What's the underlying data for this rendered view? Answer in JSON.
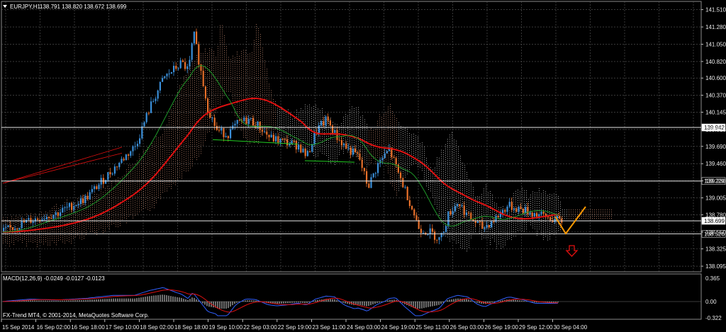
{
  "header": {
    "symbol_label": "EURJPY,H1",
    "ohlc_text": "138.791 138.820 138.672 138.699",
    "dropdown_icon": "triangle-down-icon"
  },
  "price_axis": {
    "ticks": [
      "141.510",
      "141.280",
      "141.050",
      "140.820",
      "140.600",
      "140.370",
      "140.145",
      "139.915",
      "139.690",
      "139.460",
      "139.230",
      "139.005",
      "138.780",
      "138.550",
      "138.325",
      "138.095"
    ]
  },
  "hlines": [
    {
      "value": "139.942",
      "color": "#e8e8e8",
      "label_bg": "#ffffff",
      "label_color": "#000000"
    },
    {
      "value": "139.229",
      "color": "#e8e8e8",
      "label_bg": "#000000",
      "label_color": "#ffffff"
    },
    {
      "value": "138.699",
      "color": "#e8e8e8",
      "label_bg": "#ffffff",
      "label_color": "#000000"
    },
    {
      "value": "138.526",
      "color": "#e8e8e8",
      "label_bg": "#000000",
      "label_color": "#ffffff"
    }
  ],
  "time_axis": {
    "ticks": [
      "15 Sep 2014",
      "16 Sep 02:00",
      "16 Sep 18:00",
      "17 Sep 10:00",
      "18 Sep 02:00",
      "18 Sep 18:00",
      "19 Sep 10:00",
      "22 Sep 03:00",
      "22 Sep 19:00",
      "23 Sep 11:00",
      "24 Sep 03:00",
      "24 Sep 19:00",
      "25 Sep 11:00",
      "26 Sep 03:00",
      "26 Sep 19:00",
      "29 Sep 12:00",
      "30 Sep 04:00"
    ]
  },
  "macd": {
    "label": "MACD(12,26,9) -0.0249 -0.0127 -0.0123",
    "ticks": [
      "0.365",
      "0.00",
      "-0.322"
    ]
  },
  "watermark": "FX-Trend MT4, © 2001-2014, MetaQuotes Software Corp.",
  "colors": {
    "bull": "#3a8fd9",
    "bear": "#e8702a",
    "grid": "#5a5a5a",
    "ma_red": "#e01010",
    "ma_green": "#1f9a2a",
    "cloud": "#c48a70",
    "cloud2": "#cccccc",
    "orange": "#ff9900",
    "arrow": "#e01010"
  },
  "annotation": {
    "arrow_icon": "red-down-arrow-icon"
  }
}
